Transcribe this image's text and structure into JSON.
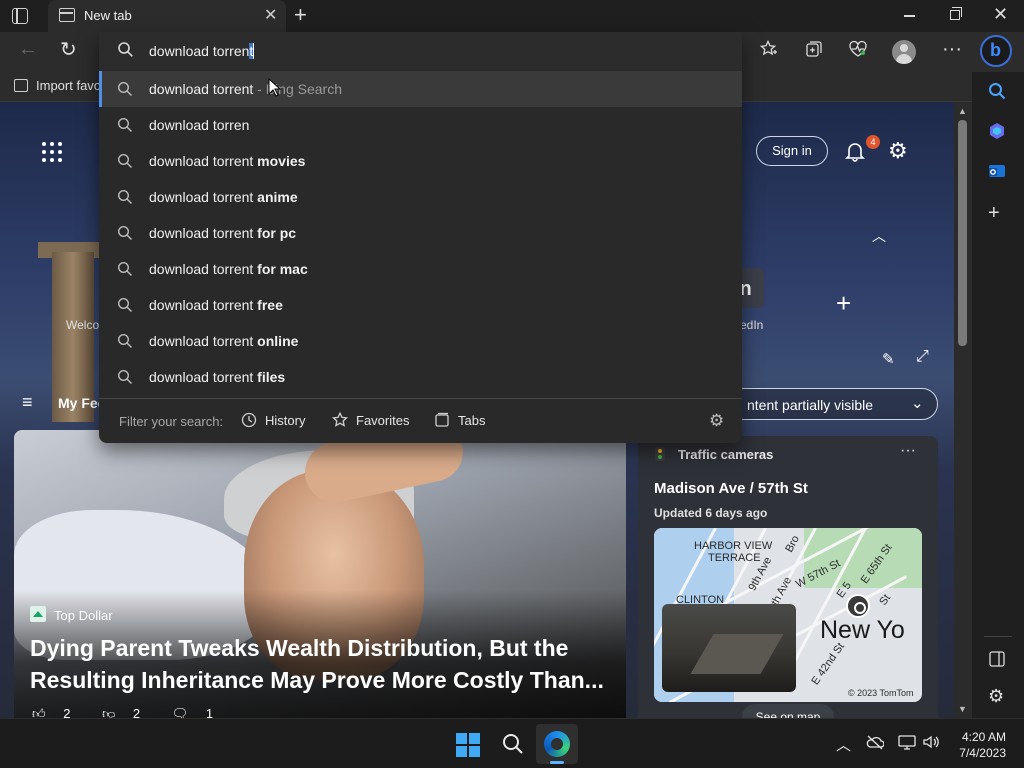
{
  "browser": {
    "tab_title": "New tab",
    "tab_close": "✕",
    "new_tab": "+",
    "window_controls": {
      "close": "✕"
    },
    "favorites_bar": {
      "import_label": "Import favo"
    },
    "toolbar_icons": [
      "favorites-star-icon",
      "collections-icon",
      "browser-essentials-icon",
      "profile-avatar",
      "more-icon",
      "copilot-icon"
    ]
  },
  "omnibox": {
    "typed": "download torren",
    "autocomplete": "t",
    "suggestions": [
      {
        "base": "download torrent",
        "bold": "",
        "suffix": " - Bing Search",
        "highlighted": true
      },
      {
        "base": "download torren",
        "bold": "",
        "suffix": "",
        "highlighted": false
      },
      {
        "base": "download torrent",
        "bold": " movies",
        "suffix": "",
        "highlighted": false
      },
      {
        "base": "download torrent",
        "bold": " anime",
        "suffix": "",
        "highlighted": false
      },
      {
        "base": "download torrent",
        "bold": " for pc",
        "suffix": "",
        "highlighted": false
      },
      {
        "base": "download torrent",
        "bold": " for mac",
        "suffix": "",
        "highlighted": false
      },
      {
        "base": "download torrent",
        "bold": " free",
        "suffix": "",
        "highlighted": false
      },
      {
        "base": "download torrent",
        "bold": " online",
        "suffix": "",
        "highlighted": false
      },
      {
        "base": "download torrent",
        "bold": " files",
        "suffix": "",
        "highlighted": false
      }
    ],
    "filter_label": "Filter your search:",
    "filters": [
      "History",
      "Favorites",
      "Tabs"
    ]
  },
  "page": {
    "signin_label": "Sign in",
    "notification_count": "4",
    "quick_links": [
      {
        "label": "Welco",
        "icon": "welcome-icon"
      },
      {
        "label": "edIn",
        "icon": "linkedin-icon",
        "glyph": "in"
      }
    ],
    "add_link": "+",
    "feed_tab": "My Fee",
    "visibility_select": "ntent partially visible",
    "hero": {
      "source": "Top Dollar",
      "headline_line1": "Dying Parent Tweaks Wealth Distribution, But the",
      "headline_line2": "Resulting Inheritance May Prove More Costly Than...",
      "likes": "2",
      "dislikes": "2",
      "comments": "1"
    },
    "traffic_card": {
      "title": "Traffic cameras",
      "location": "Madison Ave / 57th St",
      "updated": "Updated 6 days ago",
      "map_labels": [
        "HARBOR VIEW",
        "TERRACE",
        "CLINTON",
        "W 57th St",
        "E 65th St",
        "E 42nd St",
        "8th Ave",
        "9th Ave",
        "Bro",
        "E 5",
        "St"
      ],
      "map_city": "New Yo",
      "map_copyright": "© 2023 TomTom",
      "see_map": "See on map"
    }
  },
  "taskbar": {
    "time": "4:20 AM",
    "date": "7/4/2023"
  },
  "colors": {
    "accent": "#3a78c9",
    "badge": "#e0552d",
    "start": "#3fa9f5"
  }
}
